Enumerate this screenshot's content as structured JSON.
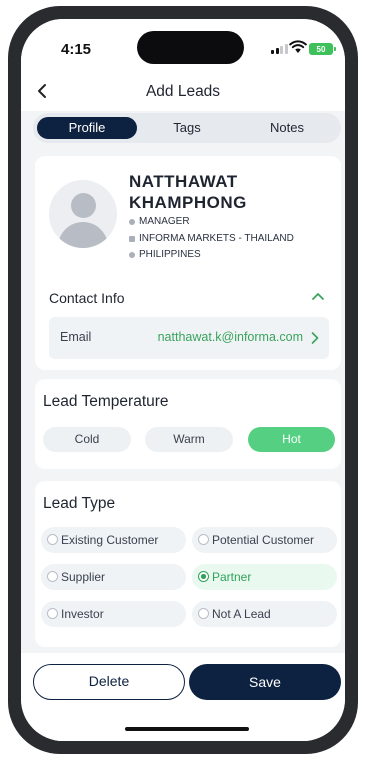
{
  "status_bar": {
    "time": "4:15",
    "battery": "50"
  },
  "nav": {
    "title": "Add Leads"
  },
  "tabs": [
    {
      "label": "Profile",
      "active": true
    },
    {
      "label": "Tags",
      "active": false
    },
    {
      "label": "Notes",
      "active": false
    }
  ],
  "profile": {
    "name_line1": "NATTHAWAT",
    "name_line2": "KHAMPHONG",
    "title": "MANAGER",
    "company": "INFORMA MARKETS - THAILAND",
    "country": "PHILIPPINES"
  },
  "contact": {
    "heading": "Contact Info",
    "email_label": "Email",
    "email_value": "natthawat.k@informa.com"
  },
  "lead_temperature": {
    "heading": "Lead Temperature",
    "options": [
      "Cold",
      "Warm",
      "Hot"
    ],
    "selected": "Hot"
  },
  "lead_type": {
    "heading": "Lead Type",
    "options": [
      "Existing Customer",
      "Potential Customer",
      "Supplier",
      "Partner",
      "Investor",
      "Not A Lead"
    ],
    "selected": "Partner"
  },
  "actions": {
    "delete_label": "Delete",
    "save_label": "Save"
  },
  "colors": {
    "navy": "#0d2140",
    "green": "#55d083",
    "green_text": "#3aa35d"
  }
}
